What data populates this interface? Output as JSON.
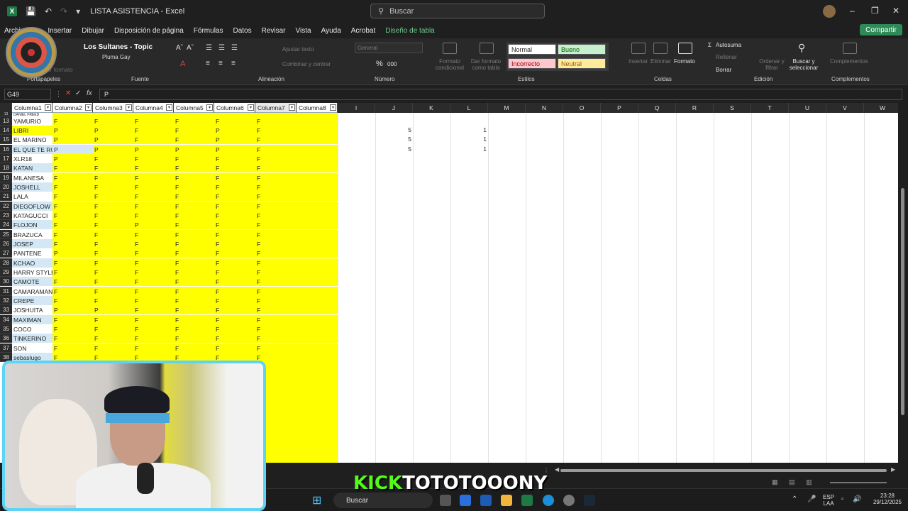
{
  "window": {
    "title": "LISTA ASISTENCIA  -  Excel",
    "search_placeholder": "Buscar",
    "share": "Compartir"
  },
  "menu": [
    "Archivo",
    "Insertar",
    "Dibujar",
    "Disposición de página",
    "Fórmulas",
    "Datos",
    "Revisar",
    "Vista",
    "Ayuda",
    "Acrobat",
    "Diseño de tabla"
  ],
  "ribbon": {
    "groups": [
      "Portapapeles",
      "Fuente",
      "Alineación",
      "Número",
      "Estilos",
      "Celdas",
      "Edición",
      "Complementos"
    ],
    "alineacion_items": [
      "Ajustar texto",
      "Combinar y centrar"
    ],
    "numero_format": "General",
    "styles": [
      "Normal",
      "Bueno",
      "Incorrecto",
      "Neutral"
    ],
    "estilos_items": [
      "Formato condicional",
      "Dar formato como tabla"
    ],
    "celdas_items": [
      "Insertar",
      "Eliminar",
      "Formato"
    ],
    "edicion_items": [
      "Autosuma",
      "Rellenar",
      "Borrar",
      "Ordenar y filtrar",
      "Buscar y seleccionar"
    ],
    "complementos": "Complementos",
    "fuente_hint": "piar formato"
  },
  "music": {
    "title": "Los Sultanes - Topic",
    "subtitle": "Pluma Gay"
  },
  "formula_bar": {
    "namebox": "G49",
    "value": "P"
  },
  "grid": {
    "table_headers": [
      "Columna1",
      "Columna2",
      "Columna3",
      "Columna4",
      "Columna5",
      "Columna6",
      "Columna7",
      "Columna8"
    ],
    "letter_headers": [
      "I",
      "J",
      "K",
      "L",
      "M",
      "N",
      "O",
      "P",
      "Q",
      "R",
      "S",
      "T",
      "U",
      "V",
      "W"
    ],
    "rows": [
      {
        "n": "13",
        "name": "DANIEL FREED",
        "v": [
          "",
          "",
          "",
          "",
          "",
          ""
        ],
        "band": false
      },
      {
        "n": "13",
        "name": "YAMURIO",
        "v": [
          "F",
          "F",
          "F",
          "F",
          "F",
          "F"
        ],
        "band": false
      },
      {
        "n": "14",
        "name": "LIBRI",
        "v": [
          "P",
          "P",
          "F",
          "F",
          "P",
          "F"
        ],
        "band": true,
        "hl": true,
        "j": "5",
        "l": "1"
      },
      {
        "n": "15",
        "name": "EL MARINO",
        "v": [
          "P",
          "P",
          "F",
          "F",
          "P",
          "F"
        ],
        "band": false,
        "j": "5",
        "l": "1"
      },
      {
        "n": "16",
        "name": "EL QUE TE ROMP",
        "v": [
          "P",
          "P",
          "P",
          "P",
          "P",
          "F"
        ],
        "band": true,
        "hl2": true,
        "j": "5",
        "l": "1"
      },
      {
        "n": "17",
        "name": "XLR18",
        "v": [
          "P",
          "F",
          "F",
          "F",
          "F",
          "F"
        ],
        "band": false
      },
      {
        "n": "18",
        "name": "KATAN",
        "v": [
          "F",
          "F",
          "F",
          "F",
          "F",
          "F"
        ],
        "band": true
      },
      {
        "n": "19",
        "name": "MILANESA",
        "v": [
          "F",
          "F",
          "F",
          "F",
          "F",
          "F"
        ],
        "band": false
      },
      {
        "n": "20",
        "name": "JOSHELL",
        "v": [
          "F",
          "F",
          "F",
          "F",
          "F",
          "F"
        ],
        "band": true
      },
      {
        "n": "21",
        "name": "LALA",
        "v": [
          "F",
          "F",
          "F",
          "F",
          "F",
          "F"
        ],
        "band": false
      },
      {
        "n": "22",
        "name": "DIEGOFLOW",
        "v": [
          "F",
          "F",
          "F",
          "F",
          "F",
          "F"
        ],
        "band": true
      },
      {
        "n": "23",
        "name": "KATAGUCCI",
        "v": [
          "F",
          "F",
          "F",
          "F",
          "F",
          "F"
        ],
        "band": false
      },
      {
        "n": "24",
        "name": "FLOJON",
        "v": [
          "F",
          "F",
          "P",
          "F",
          "F",
          "F"
        ],
        "band": true
      },
      {
        "n": "25",
        "name": "BRAZUCA",
        "v": [
          "F",
          "F",
          "F",
          "F",
          "F",
          "F"
        ],
        "band": false
      },
      {
        "n": "26",
        "name": "JOSEP",
        "v": [
          "F",
          "F",
          "F",
          "F",
          "F",
          "F"
        ],
        "band": true
      },
      {
        "n": "27",
        "name": "PANTENE",
        "v": [
          "P",
          "F",
          "F",
          "F",
          "F",
          "F"
        ],
        "band": false
      },
      {
        "n": "28",
        "name": "KCHAO",
        "v": [
          "F",
          "F",
          "F",
          "F",
          "F",
          "F"
        ],
        "band": true
      },
      {
        "n": "29",
        "name": "HARRY STYLE",
        "v": [
          "F",
          "F",
          "F",
          "F",
          "F",
          "F"
        ],
        "band": false
      },
      {
        "n": "30",
        "name": "CAMOTE",
        "v": [
          "F",
          "F",
          "F",
          "F",
          "F",
          "F"
        ],
        "band": true
      },
      {
        "n": "31",
        "name": "CAMARAMAN",
        "v": [
          "F",
          "F",
          "F",
          "F",
          "F",
          "F"
        ],
        "band": false
      },
      {
        "n": "32",
        "name": "CREPE",
        "v": [
          "F",
          "F",
          "F",
          "F",
          "F",
          "F"
        ],
        "band": true
      },
      {
        "n": "33",
        "name": "JOSHUITA",
        "v": [
          "P",
          "P",
          "F",
          "F",
          "F",
          "F"
        ],
        "band": false
      },
      {
        "n": "34",
        "name": "MAXIMAN",
        "v": [
          "F",
          "F",
          "F",
          "F",
          "F",
          "F"
        ],
        "band": true
      },
      {
        "n": "35",
        "name": "COCO",
        "v": [
          "F",
          "F",
          "F",
          "F",
          "F",
          "F"
        ],
        "band": false
      },
      {
        "n": "36",
        "name": "TINKERINO",
        "v": [
          "F",
          "F",
          "F",
          "F",
          "F",
          "F"
        ],
        "band": true
      },
      {
        "n": "37",
        "name": "SON",
        "v": [
          "F",
          "F",
          "F",
          "F",
          "F",
          "F"
        ],
        "band": false
      },
      {
        "n": "38",
        "name": "sebaslugo",
        "v": [
          "F",
          "F",
          "F",
          "F",
          "F",
          "F"
        ],
        "band": true
      }
    ]
  },
  "taskbar": {
    "search": "Buscar",
    "lang": "ESP",
    "lang2": "LAA",
    "time": "23:28",
    "date": "29/12/2025"
  },
  "overlay": {
    "kick1": "KICK",
    "kick2": "TOTOTOOONY"
  }
}
